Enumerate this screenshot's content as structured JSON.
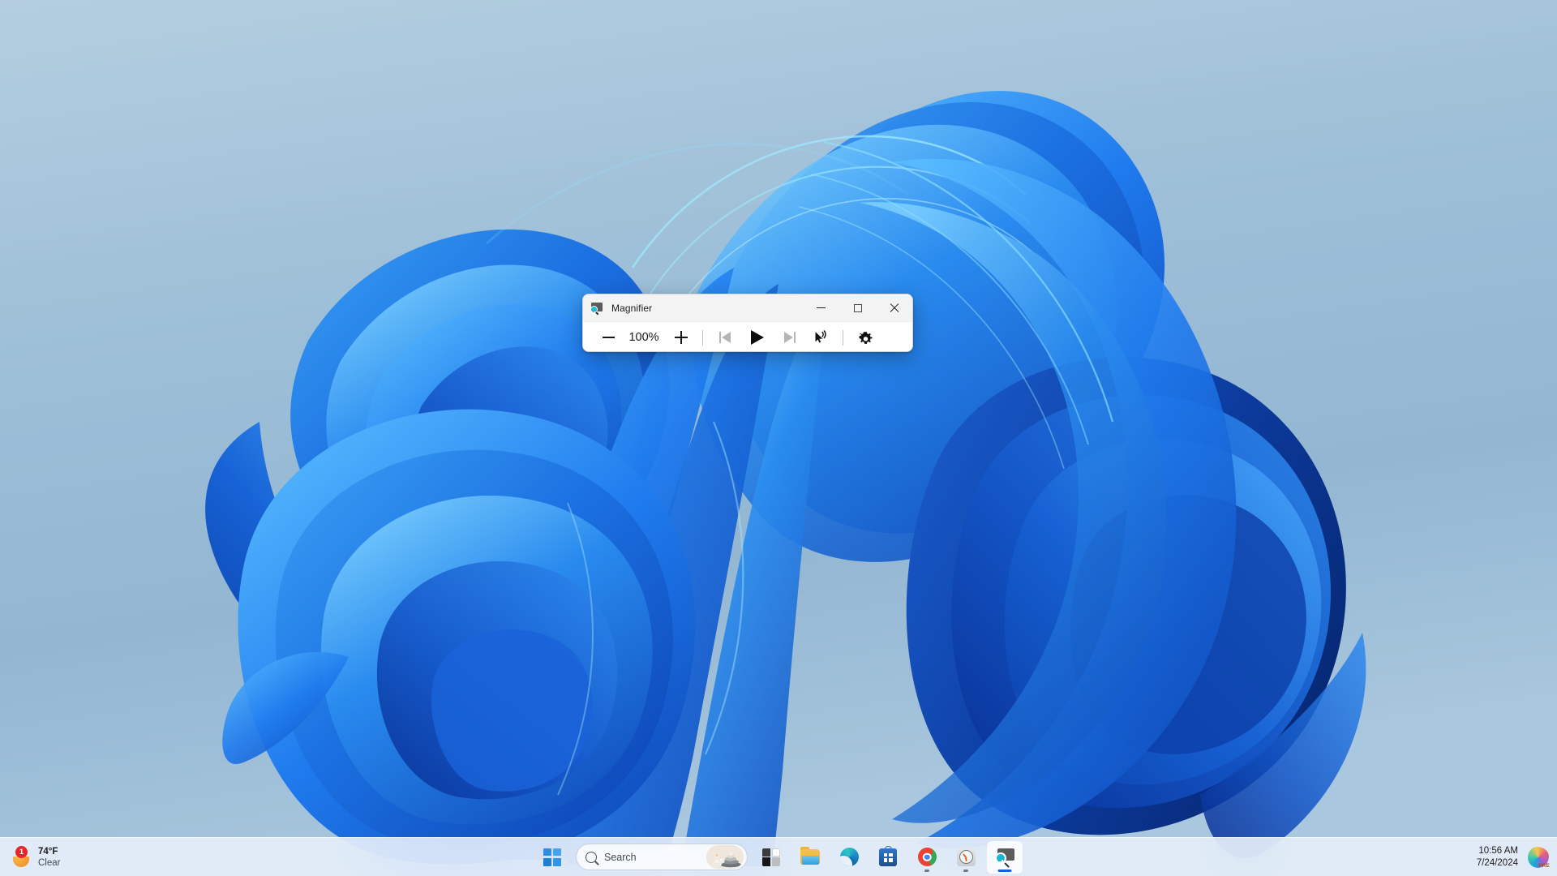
{
  "window": {
    "title": "Magnifier",
    "app_icon": "magnifier-icon",
    "caption": {
      "minimize": "minimize-icon",
      "maximize": "maximize-icon",
      "close": "close-icon"
    },
    "toolbar": {
      "zoom_out_label": "zoom-out-icon",
      "zoom_level": "100%",
      "zoom_in_label": "zoom-in-icon",
      "previous_label": "previous-sentence-icon",
      "play_label": "play-icon",
      "next_label": "next-sentence-icon",
      "read_aloud_label": "read-from-here-icon",
      "settings_label": "settings-gear-icon"
    }
  },
  "taskbar": {
    "weather": {
      "badge": "1",
      "temperature": "74°F",
      "condition": "Clear",
      "icon": "moon-icon"
    },
    "start": {
      "label": "Start",
      "icon": "windows-logo-icon"
    },
    "search": {
      "placeholder": "Search",
      "icon": "search-icon",
      "thumbnail": "zen-stones-thumbnail"
    },
    "items": [
      {
        "name": "widgets",
        "label": "Widgets",
        "icon": "widgets-icon",
        "running": false,
        "active": false
      },
      {
        "name": "file-explorer",
        "label": "File Explorer",
        "icon": "folder-icon",
        "running": false,
        "active": false
      },
      {
        "name": "microsoft-edge",
        "label": "Microsoft Edge",
        "icon": "edge-icon",
        "running": false,
        "active": false
      },
      {
        "name": "microsoft-store",
        "label": "Microsoft Store",
        "icon": "store-icon",
        "running": false,
        "active": false
      },
      {
        "name": "google-chrome",
        "label": "Google Chrome",
        "icon": "chrome-icon",
        "running": true,
        "active": false
      },
      {
        "name": "clock",
        "label": "Clock",
        "icon": "alarm-clock-icon",
        "running": true,
        "active": false
      },
      {
        "name": "magnifier",
        "label": "Magnifier",
        "icon": "magnifier-icon",
        "running": true,
        "active": true
      }
    ],
    "tray": {
      "time": "10:56 AM",
      "date": "7/24/2024",
      "copilot": {
        "icon": "copilot-icon",
        "badge": "PRE"
      }
    }
  },
  "desktop": {
    "wallpaper": "windows-11-bloom-blue",
    "background_color": "#9dbdd6"
  },
  "colors": {
    "accent": "#0d68d1",
    "window_titlebar": "#f3f3f3",
    "window_body": "#ffffff",
    "taskbar": "#e8f0fa",
    "weather_badge": "#e4262b"
  }
}
